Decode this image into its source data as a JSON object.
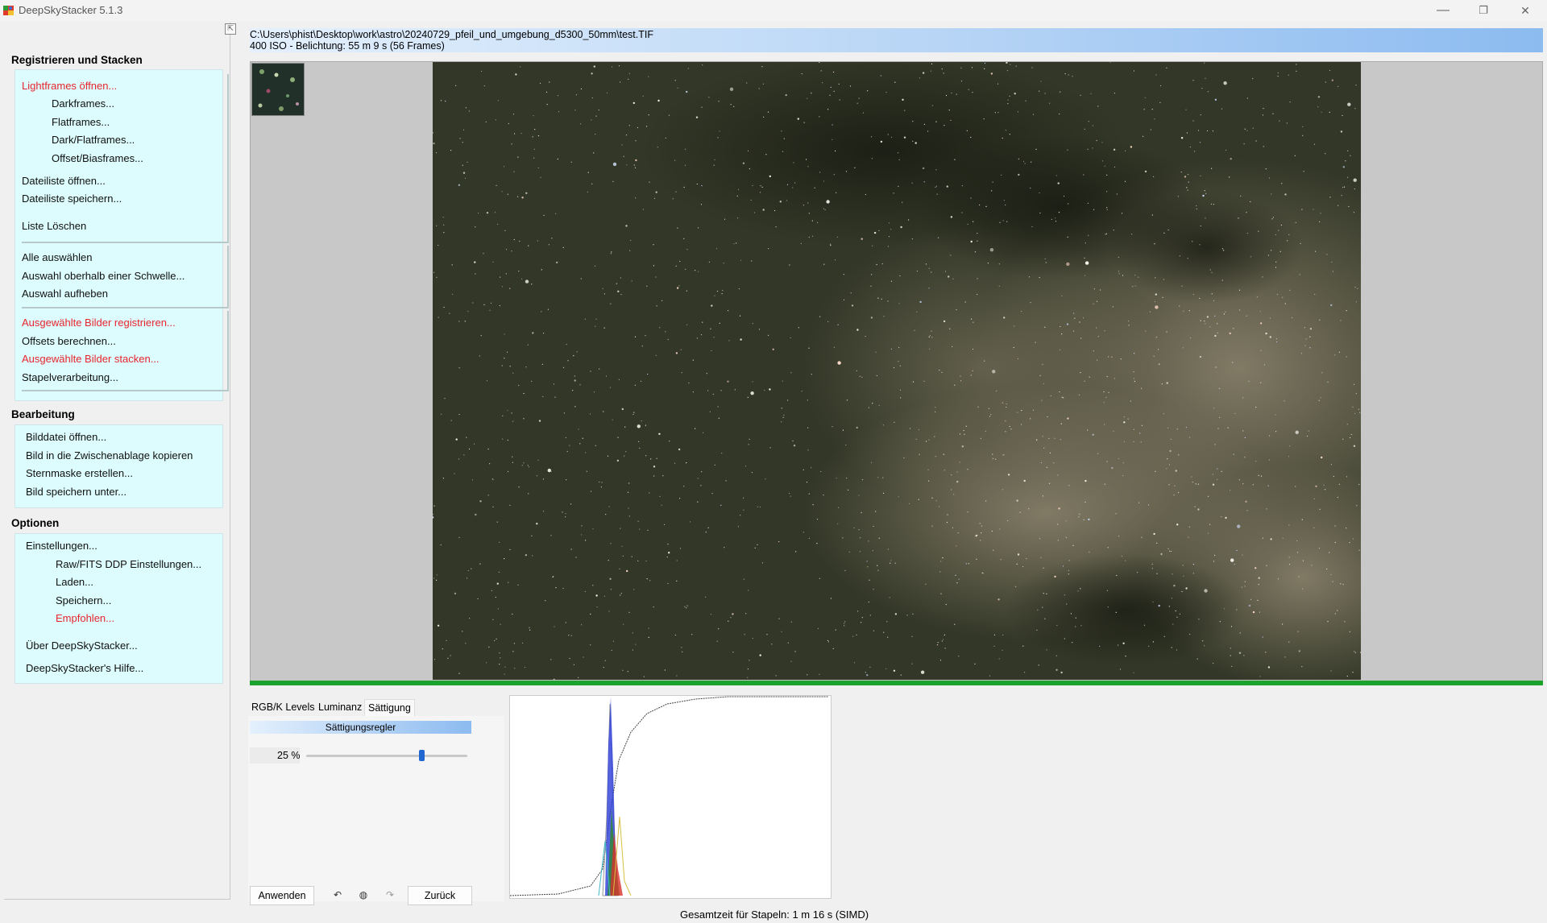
{
  "window": {
    "title": "DeepSkyStacker 5.1.3",
    "minimize_glyph": "—",
    "restore_glyph": "❐",
    "close_glyph": "✕"
  },
  "sidebar": {
    "pin_glyph": "⇱",
    "sections": {
      "register": {
        "title": "Registrieren und Stacken",
        "open_lightframes": "Lightframes öffnen...",
        "darkframes": "Darkframes...",
        "flatframes": "Flatframes...",
        "dark_flatframes": "Dark/Flatframes...",
        "offset_biasframes": "Offset/Biasframes...",
        "open_file_list": "Dateiliste öffnen...",
        "save_file_list": "Dateiliste speichern...",
        "clear_list": "Liste Löschen",
        "select_all": "Alle auswählen",
        "select_above_threshold": "Auswahl oberhalb einer Schwelle...",
        "clear_selection": "Auswahl aufheben",
        "register_selected": "Ausgewählte Bilder registrieren...",
        "compute_offsets": "Offsets berechnen...",
        "stack_selected": "Ausgewählte Bilder stacken...",
        "batch_stacking": "Stapelverarbeitung..."
      },
      "editing": {
        "title": "Bearbeitung",
        "open_image": "Bilddatei öffnen...",
        "copy_to_clipboard": "Bild in die Zwischenablage kopieren",
        "create_star_mask": "Sternmaske erstellen...",
        "save_image_as": "Bild speichern unter..."
      },
      "options": {
        "title": "Optionen",
        "settings": "Einstellungen...",
        "raw_fits_settings": "Raw/FITS DDP Einstellungen...",
        "load": "Laden...",
        "save": "Speichern...",
        "recommended": "Empfohlen...",
        "about": "Über DeepSkyStacker...",
        "help": "DeepSkyStacker's Hilfe..."
      }
    }
  },
  "header": {
    "file_path": "C:\\Users\\phist\\Desktop\\work\\astro\\20240729_pfeil_und_umgebung_d5300_50mm\\test.TIF",
    "file_info": "400 ISO - Belichtung: 55 m 9 s (56 Frames)"
  },
  "progress": {
    "fraction": 1.0
  },
  "tabs": {
    "rgb_levels": "RGB/K Levels",
    "luminance": "Luminanz",
    "saturation": "Sättigung",
    "active": "saturation"
  },
  "saturation_panel": {
    "header": "Sättigungsregler",
    "value_text": "25 %",
    "value_percent": 25
  },
  "buttons": {
    "apply": "Anwenden",
    "undo_glyph": "↶",
    "settings_glyph": "◍",
    "redo_glyph": "↷",
    "reset": "Zurück"
  },
  "status": {
    "total_time": "Gesamtzeit für Stapeln: 1 m 16 s (SIMD)"
  },
  "colors": {
    "accent_red": "#e8262e",
    "panel_cyan": "#dcfcfd",
    "progress_green": "#1ca32e",
    "header_blue": "#8cbbf0"
  }
}
